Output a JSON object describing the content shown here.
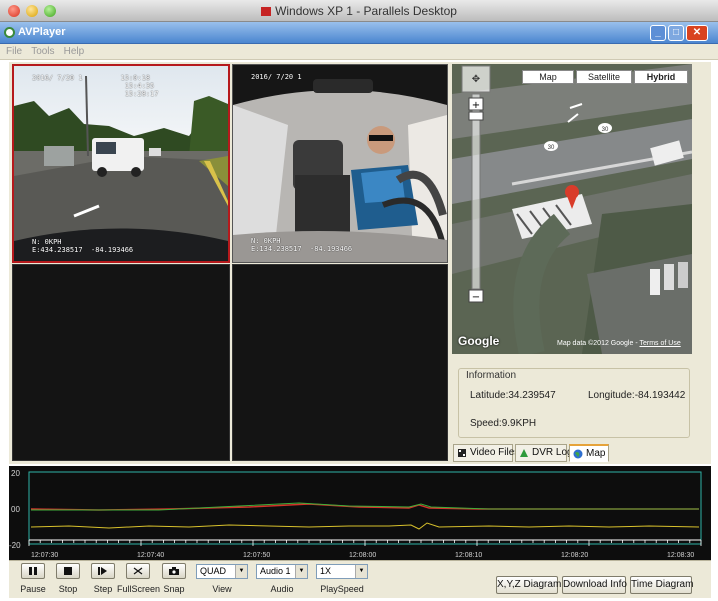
{
  "host_window": {
    "title": "Windows XP 1 - Parallels Desktop"
  },
  "app_window": {
    "title": "AVPlayer"
  },
  "menu": [
    "File",
    "Tools",
    "Help"
  ],
  "cameras": [
    {
      "id": "cam-1",
      "selected": true,
      "osd_top": "2016/ 7/20 1         15:0:18\n                      15:4:35\n                      15:28:17",
      "osd_bottom": "N: 0KPH\nE:434.238517  -84.193466"
    },
    {
      "id": "cam-2",
      "selected": false,
      "osd_top": "2016/ 7/20 1",
      "osd_bottom": "N: 0KPH\nE:134.238517  -84.193466"
    },
    {
      "id": "cam-3",
      "selected": false
    },
    {
      "id": "cam-4",
      "selected": false
    }
  ],
  "map": {
    "buttons": [
      "Map",
      "Satellite",
      "Hybrid"
    ],
    "active_button": "Hybrid",
    "footer_text": "Map data ©2012 Google - ",
    "footer_link": "Terms of Use",
    "logo": "Google",
    "road_labels": [
      "30",
      "30"
    ]
  },
  "information": {
    "legend": "Information",
    "latitude": "Latitude:34.239547",
    "longitude": "Longitude:-84.193442",
    "speed": "Speed:9.9KPH"
  },
  "tabs": [
    {
      "label": "Video Files",
      "icon": "film-icon"
    },
    {
      "label": "DVR Log",
      "icon": "log-icon"
    },
    {
      "label": "Map",
      "icon": "globe-icon"
    }
  ],
  "active_tab": "Map",
  "graph": {
    "y_labels": [
      "20",
      "00",
      "-20"
    ],
    "x_labels": [
      "12:07:30",
      "12:07:40",
      "12:07:50",
      "12:08:00",
      "12:08:10",
      "12:08:20",
      "12:08:30"
    ],
    "colors": {
      "red": "#d2342a",
      "green": "#3fae3a",
      "yellow": "#d8c12c",
      "frame": "#2fb3a6"
    }
  },
  "controls": {
    "buttons": [
      {
        "name": "pause",
        "label": "Pause"
      },
      {
        "name": "stop",
        "label": "Stop"
      },
      {
        "name": "step",
        "label": "Step"
      },
      {
        "name": "fullscreen",
        "label": "FullScreen"
      },
      {
        "name": "snap",
        "label": "Snap"
      }
    ],
    "view": {
      "value": "QUAD",
      "label": "View"
    },
    "audio": {
      "value": "Audio 1",
      "label": "Audio"
    },
    "speed": {
      "value": "1X",
      "label": "PlaySpeed"
    },
    "right_buttons": [
      "X,Y,Z Diagram",
      "Download Info",
      "Time Diagram"
    ]
  }
}
